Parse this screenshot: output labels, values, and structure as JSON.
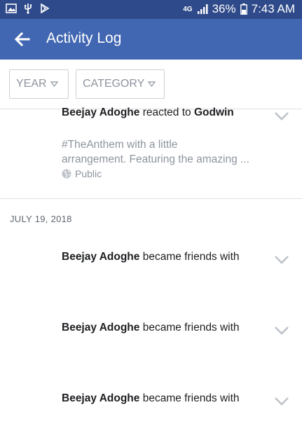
{
  "status_bar": {
    "network_type": "4G",
    "battery_percent": "36%",
    "time": "7:43 AM",
    "left_icons": [
      "image-icon",
      "usb-icon",
      "play-store-icon"
    ],
    "right_icons": [
      "signal-icon",
      "battery-icon"
    ]
  },
  "app_bar": {
    "title": "Activity Log",
    "color": "#4267b2"
  },
  "filters": {
    "year_label": "YEAR",
    "category_label": "CATEGORY"
  },
  "entries_top": {
    "name": "Beejay Adoghe",
    "action": " reacted to ",
    "target": "Godwin",
    "preview_line1": "#TheAnthem with a little",
    "preview_line2": "arrangement. Featuring the amazing ...",
    "privacy": "Public"
  },
  "date_group": {
    "label": "JULY 19, 2018",
    "entries": [
      {
        "name": "Beejay Adoghe",
        "action": " became friends with"
      },
      {
        "name": "Beejay Adoghe",
        "action": " became friends with"
      },
      {
        "name": "Beejay Adoghe",
        "action": " became friends with"
      }
    ]
  }
}
